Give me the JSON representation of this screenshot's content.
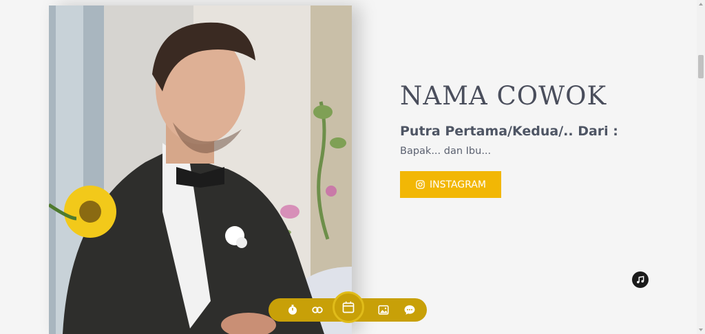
{
  "groom": {
    "name": "NAMA COWOK",
    "parent_title": "Putra Pertama/Kedua/.. Dari :",
    "parent_names": "Bapak... dan Ibu...",
    "instagram_label": "INSTAGRAM"
  },
  "photo": {
    "alt": "groom-photo"
  },
  "bottom_nav": {
    "items": [
      {
        "icon": "stopwatch-icon"
      },
      {
        "icon": "couple-icon"
      },
      {
        "icon": "calendar-icon",
        "active": true
      },
      {
        "icon": "gallery-icon"
      },
      {
        "icon": "chat-icon"
      }
    ]
  },
  "music_button": {
    "icon": "music-note-icon"
  },
  "colors": {
    "accent": "#f2b705",
    "nav_bg": "#c8a008",
    "text_dark": "#4a4e5c",
    "background": "#f5f5f5"
  }
}
